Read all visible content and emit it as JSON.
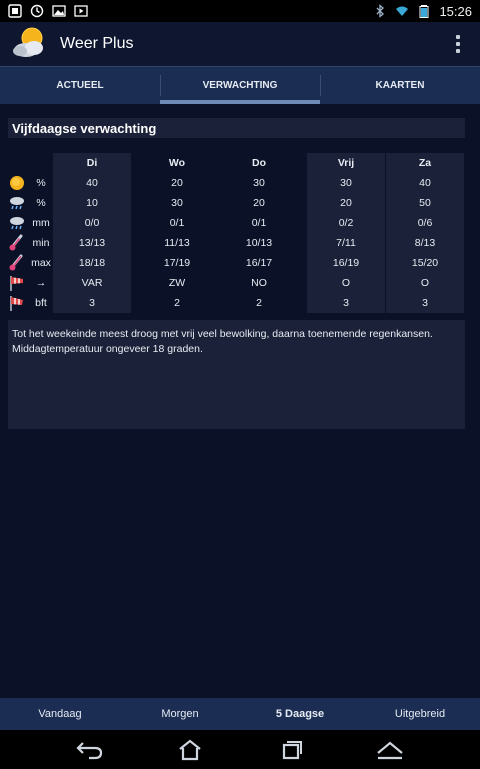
{
  "status_bar": {
    "time": "15:26",
    "left_icons": [
      "notification-icon",
      "sync-icon",
      "image-icon",
      "play-icon"
    ],
    "right_icons": [
      "bluetooth-icon",
      "wifi-icon",
      "battery-icon"
    ]
  },
  "app": {
    "title": "Weer Plus",
    "icon": "weather-sun-cloud-icon"
  },
  "tabs": [
    {
      "label": "ACTUEEL",
      "active": false
    },
    {
      "label": "VERWACHTING",
      "active": true
    },
    {
      "label": "KAARTEN",
      "active": false
    }
  ],
  "forecast": {
    "title": "Vijfdaagse verwachting",
    "days": [
      "Di",
      "Wo",
      "Do",
      "Vrij",
      "Za"
    ],
    "rows": [
      {
        "icon": "sun-icon",
        "unit": "%",
        "values": [
          "40",
          "20",
          "30",
          "30",
          "40"
        ]
      },
      {
        "icon": "rain-cloud-icon",
        "unit": "%",
        "values": [
          "10",
          "30",
          "20",
          "20",
          "50"
        ]
      },
      {
        "icon": "rain-cloud-icon",
        "unit": "mm",
        "values": [
          "0/0",
          "0/1",
          "0/1",
          "0/2",
          "0/6"
        ]
      },
      {
        "icon": "thermometer-icon",
        "unit": "min",
        "values": [
          "13/13",
          "11/13",
          "10/13",
          "7/11",
          "8/13"
        ]
      },
      {
        "icon": "thermometer-icon",
        "unit": "max",
        "values": [
          "18/18",
          "17/19",
          "16/17",
          "16/19",
          "15/20"
        ]
      },
      {
        "icon": "windsock-icon",
        "unit": "→",
        "values": [
          "VAR",
          "ZW",
          "NO",
          "O",
          "O"
        ]
      },
      {
        "icon": "windsock-icon",
        "unit": "bft",
        "values": [
          "3",
          "2",
          "2",
          "3",
          "3"
        ]
      }
    ],
    "description": "Tot het weekeinde meest droog met vrij veel bewolking, daarna toenemende regenkansen. Middagtemperatuur ongeveer 18 graden."
  },
  "bottom_nav": [
    {
      "label": "Vandaag",
      "active": false
    },
    {
      "label": "Morgen",
      "active": false
    },
    {
      "label": "5 Daagse",
      "active": true
    },
    {
      "label": "Uitgebreid",
      "active": false
    }
  ],
  "colors": {
    "background": "#0b1228",
    "tab_bar": "#1b2d52",
    "panel": "#1b2138",
    "tab_indicator": "#6f8ab5"
  }
}
